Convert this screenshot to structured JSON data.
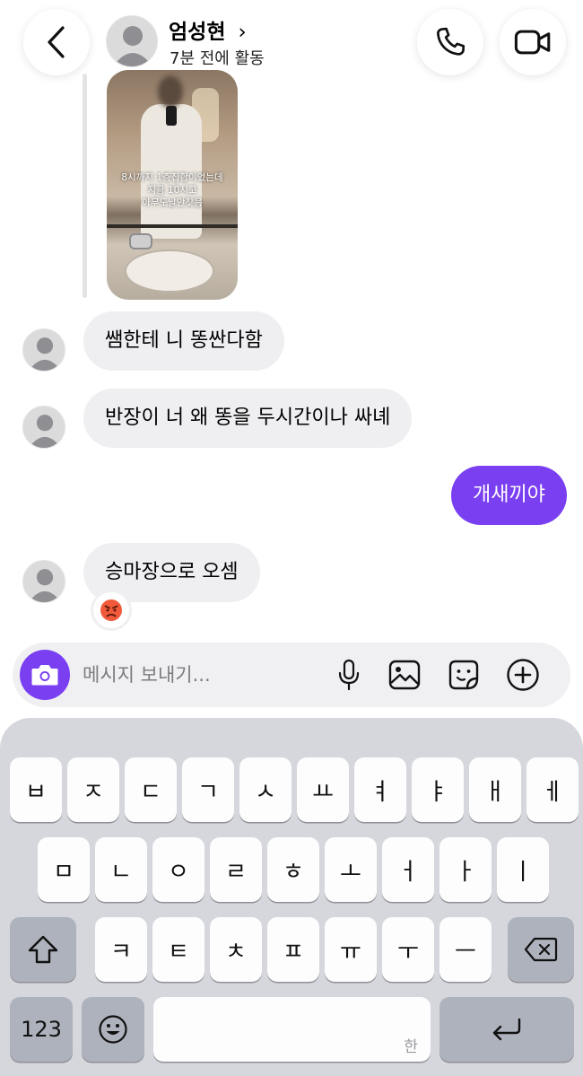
{
  "header": {
    "contact_name": "엄성현",
    "name_chevron": "›",
    "status": "7분 전에 활동",
    "back_icon": "chevron-left-icon",
    "call_icon": "phone-icon",
    "video_icon": "video-camera-icon"
  },
  "chat": {
    "photo_caption": [
      "8시까지 1층집합이었는데",
      "지금 10시고",
      "아무도날안찾음"
    ],
    "messages": [
      {
        "sender": "other",
        "text": "쌤한테 니 똥싼다함"
      },
      {
        "sender": "other",
        "text": "반장이 너 왜 똥을 두시간이나 싸녜"
      },
      {
        "sender": "me",
        "text": "개새끼야"
      },
      {
        "sender": "other",
        "text": "승마장으로 오셈"
      }
    ],
    "reaction": "😡",
    "colors": {
      "accent": "#7a3ff0",
      "bubble_other": "#efeff2"
    }
  },
  "composer": {
    "placeholder": "메시지 보내기...",
    "icons": [
      "camera-icon",
      "microphone-icon",
      "image-icon",
      "sticker-icon",
      "plus-circle-icon"
    ]
  },
  "keyboard": {
    "row1": [
      "ㅂ",
      "ㅈ",
      "ㄷ",
      "ㄱ",
      "ㅅ",
      "ㅛ",
      "ㅕ",
      "ㅑ",
      "ㅐ",
      "ㅔ"
    ],
    "row2": [
      "ㅁ",
      "ㄴ",
      "ㅇ",
      "ㄹ",
      "ㅎ",
      "ㅗ",
      "ㅓ",
      "ㅏ",
      "ㅣ"
    ],
    "row3": [
      "ㅋ",
      "ㅌ",
      "ㅊ",
      "ㅍ",
      "ㅠ",
      "ㅜ",
      "ㅡ"
    ],
    "numbers_label": "123",
    "space_hint": "한",
    "shift_icon": "shift-arrow-icon",
    "delete_icon": "backspace-icon",
    "emoji_icon": "emoji-icon",
    "return_icon": "return-arrow-icon"
  }
}
